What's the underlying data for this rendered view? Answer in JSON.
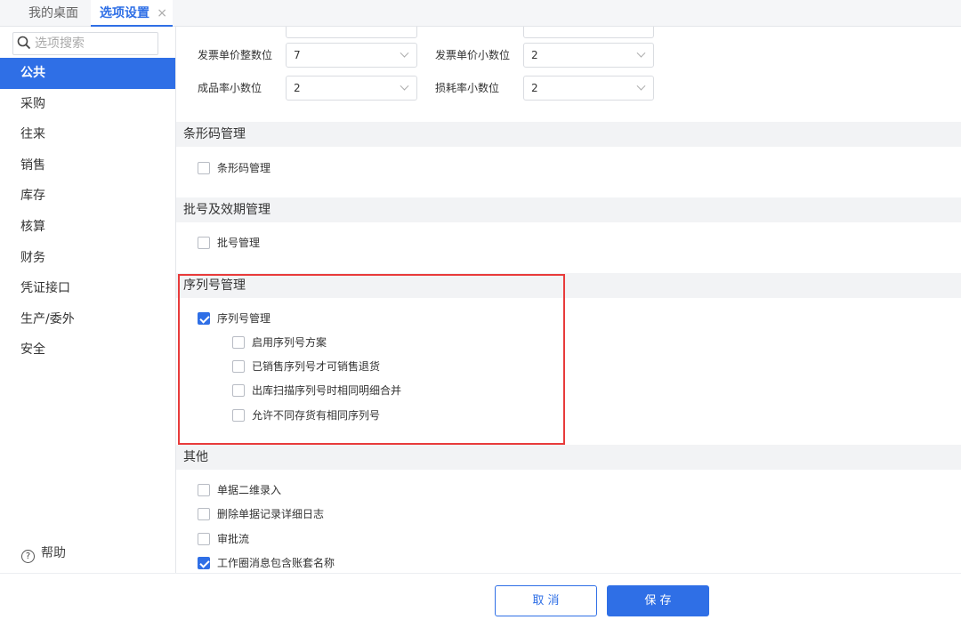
{
  "tabs": {
    "desktop": "我的桌面",
    "options": "选项设置",
    "close": "×"
  },
  "sidebar": {
    "search_placeholder": "选项搜索",
    "items": [
      "公共",
      "采购",
      "往来",
      "销售",
      "库存",
      "核算",
      "财务",
      "凭证接口",
      "生产/委外",
      "安全"
    ],
    "active_index": 0,
    "help": "帮助"
  },
  "fields": {
    "invoice_price_int_label": "发票单价整数位",
    "invoice_price_int_value": "7",
    "invoice_price_dec_label": "发票单价小数位",
    "invoice_price_dec_value": "2",
    "yield_rate_dec_label": "成品率小数位",
    "yield_rate_dec_value": "2",
    "loss_rate_dec_label": "损耗率小数位",
    "loss_rate_dec_value": "2"
  },
  "sections": {
    "barcode": {
      "title": "条形码管理",
      "option": "条形码管理",
      "checked": false
    },
    "batch": {
      "title": "批号及效期管理",
      "option": "批号管理",
      "checked": false
    },
    "serial": {
      "title": "序列号管理",
      "main_option": "序列号管理",
      "main_checked": true,
      "sub_options": [
        {
          "label": "启用序列号方案",
          "checked": false
        },
        {
          "label": "已销售序列号才可销售退货",
          "checked": false
        },
        {
          "label": "出库扫描序列号时相同明细合并",
          "checked": false
        },
        {
          "label": "允许不同存货有相同序列号",
          "checked": false
        }
      ]
    },
    "other": {
      "title": "其他",
      "options": [
        {
          "label": "单据二维录入",
          "checked": false
        },
        {
          "label": "删除单据记录详细日志",
          "checked": false
        },
        {
          "label": "审批流",
          "checked": false
        },
        {
          "label": "工作圈消息包含账套名称",
          "checked": true
        }
      ]
    }
  },
  "footer": {
    "cancel": "取 消",
    "save": "保 存"
  },
  "colors": {
    "accent": "#2f6fe6",
    "highlight": "#e83b3b"
  }
}
